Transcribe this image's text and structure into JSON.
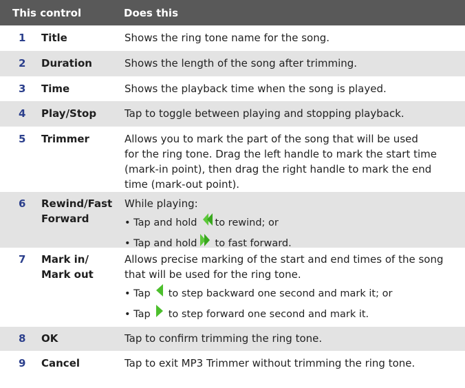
{
  "header": {
    "col1": "This control",
    "col2": "Does this"
  },
  "rows": [
    {
      "num": "1",
      "control": [
        "Title"
      ],
      "desc": [
        "Shows the ring tone name for the song."
      ],
      "bullets": []
    },
    {
      "num": "2",
      "control": [
        "Duration"
      ],
      "desc": [
        "Shows the length of the song after trimming."
      ],
      "bullets": []
    },
    {
      "num": "3",
      "control": [
        "Time"
      ],
      "desc": [
        "Shows the playback time when the song is played."
      ],
      "bullets": []
    },
    {
      "num": "4",
      "control": [
        "Play/Stop"
      ],
      "desc": [
        "Tap to toggle between playing and stopping playback."
      ],
      "bullets": []
    },
    {
      "num": "5",
      "control": [
        "Trimmer"
      ],
      "desc": [
        "Allows you to mark the part of the song that will be used",
        "for the ring tone. Drag the left handle to mark the start time",
        "(mark-in point), then drag the right handle to mark the end",
        "time (mark-out point)."
      ],
      "bullets": []
    },
    {
      "num": "6",
      "control": [
        "Rewind/Fast",
        "Forward"
      ],
      "desc": [
        "While playing:"
      ],
      "bullets": [
        {
          "pre": "• Tap and hold",
          "icon": "rewind-icon",
          "post": "to rewind; or"
        },
        {
          "pre": "• Tap and hold",
          "icon": "fast-forward-icon",
          "post": "to fast forward."
        }
      ]
    },
    {
      "num": "7",
      "control": [
        "Mark in/",
        "Mark out"
      ],
      "desc": [
        "Allows precise marking of the start and end times of the song",
        "that will be used for the ring tone."
      ],
      "bullets": [
        {
          "pre": "• Tap",
          "icon": "step-back-icon",
          "post": "to step backward one second and mark it; or"
        },
        {
          "pre": "• Tap",
          "icon": "step-forward-icon",
          "post": "to step forward one second and mark it."
        }
      ]
    },
    {
      "num": "8",
      "control": [
        "OK"
      ],
      "desc": [
        "Tap to confirm trimming the ring tone."
      ],
      "bullets": []
    },
    {
      "num": "9",
      "control": [
        "Cancel"
      ],
      "desc": [
        "Tap to exit MP3 Trimmer without trimming the ring tone."
      ],
      "bullets": []
    }
  ]
}
